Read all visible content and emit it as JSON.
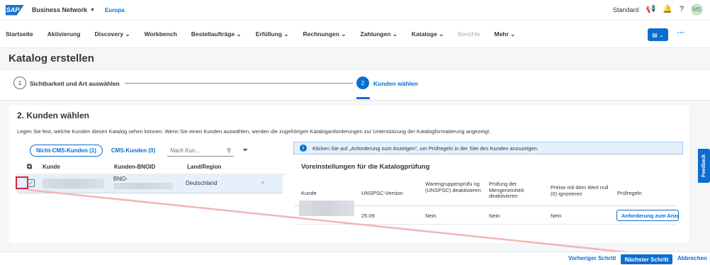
{
  "shell": {
    "logo": "SAP",
    "product": "Business Network",
    "product_caret": "▼",
    "region": "Europa",
    "mode": "Standard",
    "avatar": "MS"
  },
  "nav": {
    "items": [
      {
        "label": "Startseite"
      },
      {
        "label": "Aktivierung"
      },
      {
        "label": "Discovery ⌄"
      },
      {
        "label": "Workbench"
      },
      {
        "label": "Bestellaufträge ⌄"
      },
      {
        "label": "Erfüllung ⌄"
      },
      {
        "label": "Rechnungen ⌄"
      },
      {
        "label": "Zahlungen ⌄"
      },
      {
        "label": "Kataloge ⌄"
      },
      {
        "label": "Berichte"
      },
      {
        "label": "Mehr ⌄"
      }
    ],
    "more": "···"
  },
  "page": {
    "title": "Katalog erstellen"
  },
  "wizard": {
    "step1_num": "1",
    "step1_label": "Sichtbarkeit und Art auswählen",
    "step2_num": "2",
    "step2_label": "Kunden wählen"
  },
  "card": {
    "title": "2. Kunden wählen",
    "description": "Legen Sie fest, welche Kunden diesen Katalog sehen können. Wenn Sie einen Kunden auswählen, werden die zugehörigen Kataloganforderungen zur Unterstützung der Katalogformatierung angezeigt."
  },
  "left": {
    "tab_non_cms": "Nicht-CMS-Kunden (1)",
    "tab_cms": "CMS-Kunden (0)",
    "search_placeholder": "Nach Kun...",
    "columns": [
      "Kunde",
      "Kunden-BNOID",
      "Land/Region"
    ],
    "row": {
      "bnoid_prefix": "BNO-",
      "country": "Deutschland"
    }
  },
  "right": {
    "info": "Klicken Sie auf „Anforderung zum Anzeigen“, um Prüfregeln in der Site des Kunden anzuzeigen.",
    "title": "Voreinstellungen für die Katalogprüfung",
    "columns": [
      "Kunde",
      "UNSPSC-Version",
      "Warengruppenprüfu ng (UNSPSC) deaktivieren",
      "Prüfung der Mengeneinheit deaktivieren",
      "Preise mit dem Wert null (0) ignorieren",
      "Prüfregeln"
    ],
    "row": {
      "version": "25.09",
      "v1": "Nein",
      "v2": "Nein",
      "v3": "Nein",
      "button": "Anforderung zum Anzeigen"
    }
  },
  "feedback": "Feedback",
  "footer": {
    "prev": "Vorheriger Schritt",
    "next": "Nächster Schritt",
    "cancel": "Abbrechen"
  },
  "colors": {
    "accent": "#0a6ed1",
    "highlight": "#e0203a"
  }
}
